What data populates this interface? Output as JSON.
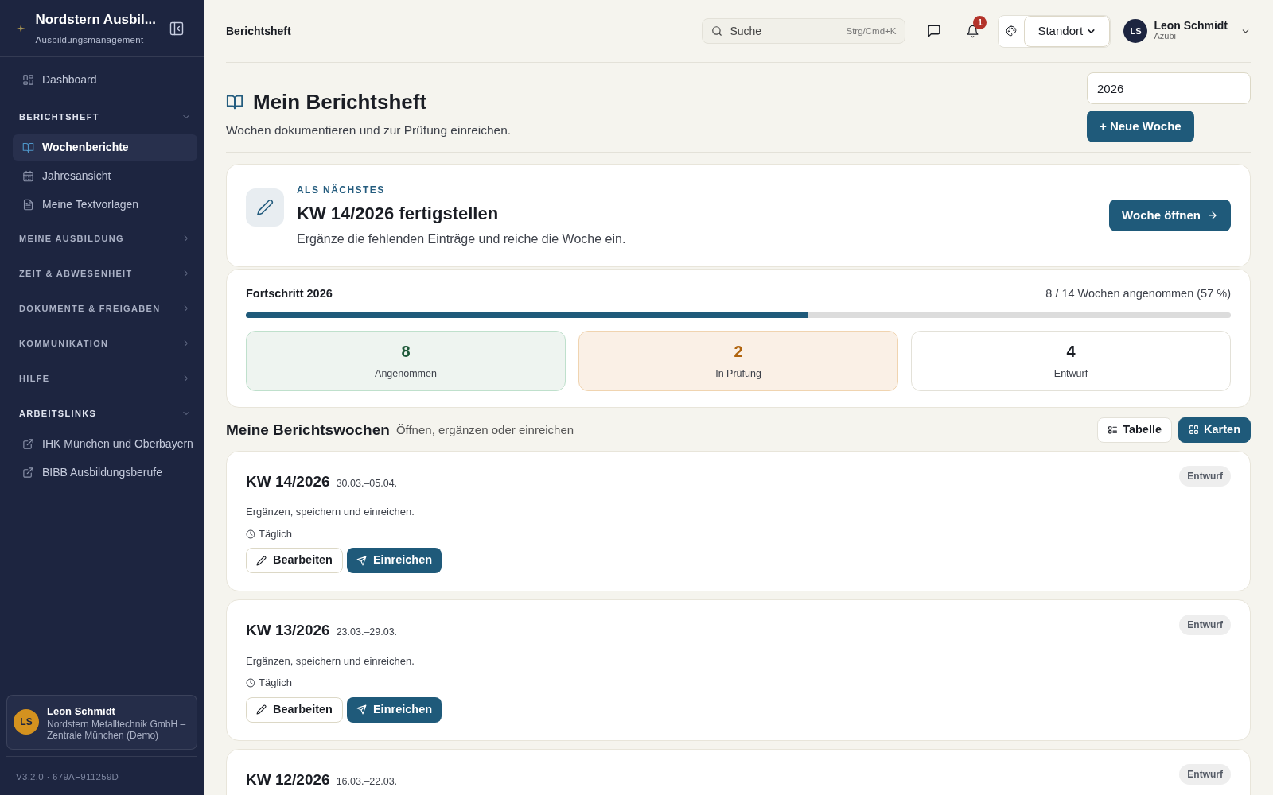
{
  "sidebar": {
    "app_name": "Nordstern Ausbil...",
    "app_subtitle": "Ausbildungsmanagement",
    "nav": [
      {
        "kind": "link",
        "label": "Dashboard",
        "selected": false
      },
      {
        "kind": "group",
        "label": "BERICHTSHEFT",
        "expanded": true,
        "children": [
          {
            "label": "Wochenberichte",
            "selected": true
          },
          {
            "label": "Jahresansicht",
            "selected": false
          },
          {
            "label": "Meine Textvorlagen",
            "selected": false
          }
        ]
      },
      {
        "kind": "group",
        "label": "MEINE AUSBILDUNG",
        "expanded": false
      },
      {
        "kind": "group",
        "label": "ZEIT & ABWESENHEIT",
        "expanded": false
      },
      {
        "kind": "group",
        "label": "DOKUMENTE & FREIGABEN",
        "expanded": false
      },
      {
        "kind": "group",
        "label": "KOMMUNIKATION",
        "expanded": false
      },
      {
        "kind": "group",
        "label": "HILFE",
        "expanded": false
      },
      {
        "kind": "group",
        "label": "ARBEITSLINKS",
        "expanded": true,
        "children": [
          {
            "label": "IHK München und Oberbayern",
            "selected": false
          },
          {
            "label": "BIBB Ausbildungsberufe",
            "selected": false
          }
        ]
      }
    ],
    "user": {
      "initials": "LS",
      "name": "Leon Schmidt",
      "org": "Nordstern Metalltechnik GmbH – Zentrale München (Demo)"
    },
    "version": "V3.2.0 · 679AF911259D"
  },
  "header": {
    "breadcrumb": "Berichtsheft",
    "search": {
      "placeholder": "Suche",
      "shortcut": "Strg/Cmd+K"
    },
    "notification_count": "1",
    "location_select": "Standort",
    "user": {
      "initials": "LS",
      "name": "Leon Schmidt",
      "role": "Azubi"
    }
  },
  "page": {
    "title": "Mein Berichtsheft",
    "subtitle": "Wochen dokumentieren und zur Prüfung einreichen.",
    "year_field": "2026",
    "new_button": "+ Neue Woche"
  },
  "next_step": {
    "eyebrow": "ALS NÄCHSTES",
    "title": "KW 14/2026 fertigstellen",
    "text": "Ergänze die fehlenden Einträge und reiche die Woche ein.",
    "button": "Woche öffnen"
  },
  "progress": {
    "title": "Fortschritt 2026",
    "summary": "8 / 14 Wochen angenommen (57 %)",
    "level": 0.571,
    "stats": [
      {
        "kind": "accepted",
        "value": "8",
        "label": "Angenommen"
      },
      {
        "kind": "review",
        "value": "2",
        "label": "In Prüfung"
      },
      {
        "kind": "draft",
        "value": "4",
        "label": "Entwurf"
      }
    ]
  },
  "weeks_section": {
    "title": "Meine Berichtswochen",
    "subtitle": "Öffnen, ergänzen oder einreichen",
    "views": [
      {
        "label": "Tabelle",
        "selected": false
      },
      {
        "label": "Karten",
        "selected": true
      }
    ]
  },
  "weeks": [
    {
      "title": "KW 14/2026",
      "dates": "30.03.–05.04.",
      "status": "Entwurf",
      "note": "Ergänzen, speichern und einreichen.",
      "frequency": "Täglich",
      "edit_button": "Bearbeiten",
      "submit_button": "Einreichen"
    },
    {
      "title": "KW 13/2026",
      "dates": "23.03.–29.03.",
      "status": "Entwurf",
      "note": "Ergänzen, speichern und einreichen.",
      "frequency": "Täglich",
      "edit_button": "Bearbeiten",
      "submit_button": "Einreichen"
    },
    {
      "title": "KW 12/2026",
      "dates": "16.03.–22.03.",
      "status": "Entwurf"
    }
  ]
}
